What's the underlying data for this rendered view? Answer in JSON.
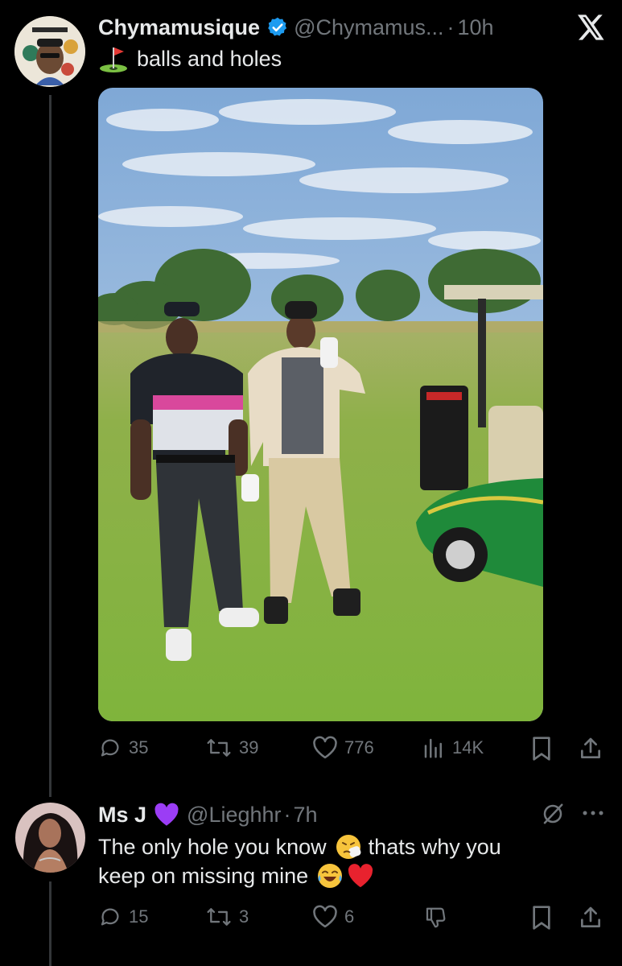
{
  "post": {
    "author_name": "Chymamusique",
    "author_handle": "@Chymamus...",
    "time": "10h",
    "text": "balls and holes",
    "stats": {
      "replies": "35",
      "reposts": "39",
      "likes": "776",
      "views": "14K"
    }
  },
  "reply": {
    "author_name": "Ms J",
    "author_handle": "@Lieghhr",
    "time": "7h",
    "line1": "The only hole you know",
    "line1b": "thats why you",
    "line2": "keep on missing mine",
    "stats": {
      "replies": "15",
      "reposts": "3",
      "likes": "6"
    }
  },
  "colors": {
    "verified": "#1d9bf0",
    "muted": "#71767b",
    "text": "#e7e9ea",
    "bg": "#000000"
  },
  "icons": [
    "flag-in-hole-icon",
    "verified-badge-icon",
    "x-logo-icon",
    "reply-icon",
    "repost-icon",
    "like-icon",
    "views-icon",
    "bookmark-icon",
    "share-icon",
    "purple-heart-icon",
    "sneezing-face-icon",
    "tears-of-joy-icon",
    "red-heart-icon",
    "grok-icon",
    "more-icon",
    "downvote-icon"
  ]
}
